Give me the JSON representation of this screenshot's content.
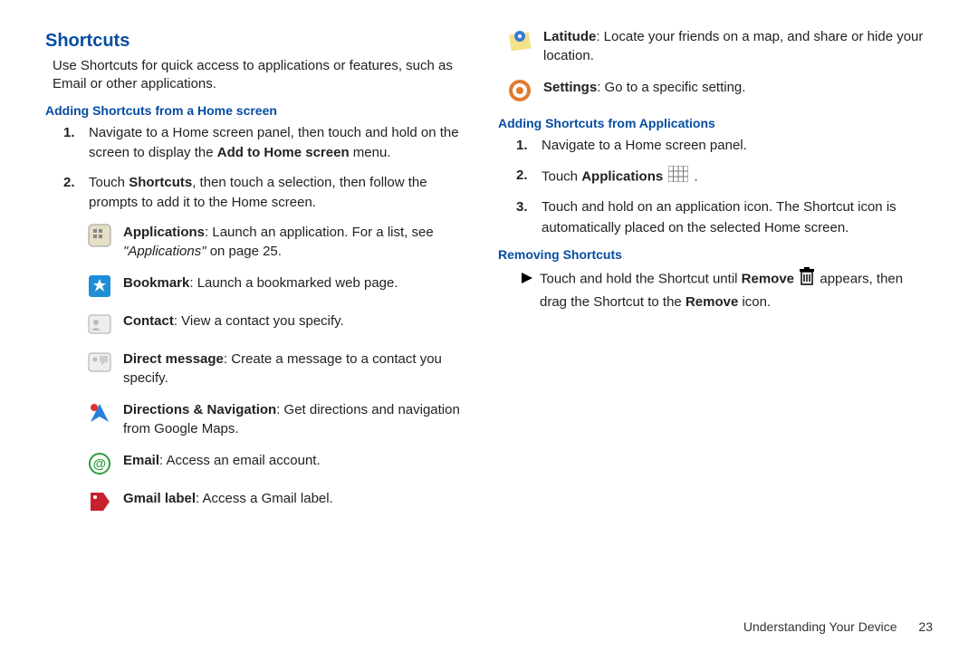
{
  "footer": {
    "section": "Understanding Your Device",
    "page": "23"
  },
  "left": {
    "title": "Shortcuts",
    "intro": "Use Shortcuts for quick access to applications or features, such as Email or other applications.",
    "sub1": "Adding Shortcuts from a Home screen",
    "step1_a": "Navigate to a Home screen panel, then touch and hold on the screen to display the ",
    "step1_b": "Add to Home screen",
    "step1_c": " menu.",
    "step2_a": "Touch ",
    "step2_b": "Shortcuts",
    "step2_c": ", then touch a selection, then follow the prompts to add it to the Home screen.",
    "apps_label": "Applications",
    "apps_text": ": Launch an application. For a list, see ",
    "apps_ref": "\"Applications\"",
    "apps_ref2": " on page 25.",
    "bookmark_label": "Bookmark",
    "bookmark_text": ": Launch a bookmarked web page.",
    "contact_label": "Contact",
    "contact_text": ": View a contact you specify.",
    "dm_label": "Direct message",
    "dm_text": ": Create a message to a contact you specify.",
    "dn_label": "Directions & Navigation",
    "dn_text": ": Get directions and navigation from Google Maps.",
    "email_label": "Email",
    "email_text": ": Access an email account.",
    "gmail_label": "Gmail label",
    "gmail_text": ": Access a Gmail label."
  },
  "right": {
    "lat_label": "Latitude",
    "lat_text": ": Locate your friends on a map, and share or hide your location.",
    "set_label": "Settings",
    "set_text": ": Go to a specific setting.",
    "sub2": "Adding Shortcuts from Applications",
    "r_step1": "Navigate to a Home screen panel.",
    "r_step2_a": "Touch ",
    "r_step2_b": "Applications",
    "r_step2_c": " .",
    "r_step3": "Touch and hold on an application icon. The Shortcut icon is automatically placed on the selected Home screen.",
    "sub3": "Removing Shortcuts",
    "rem_a": "Touch and hold the Shortcut until ",
    "rem_b": "Remove",
    "rem_c": " appears, then drag the Shortcut to the ",
    "rem_d": "Remove",
    "rem_e": " icon."
  }
}
